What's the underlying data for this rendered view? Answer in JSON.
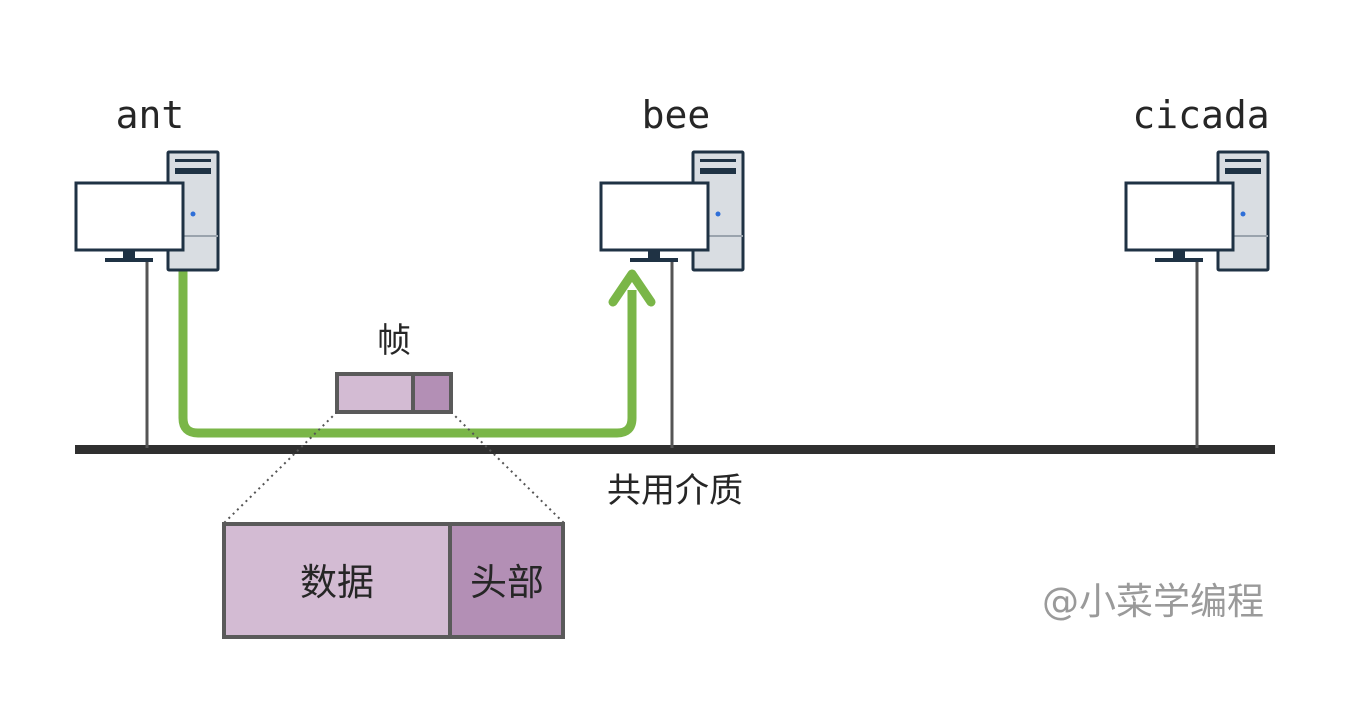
{
  "hosts": [
    {
      "name": "ant"
    },
    {
      "name": "bee"
    },
    {
      "name": "cicada"
    }
  ],
  "frame_label": "帧",
  "medium_label": "共用介质",
  "frame_parts": {
    "data_label": "数据",
    "header_label": "头部"
  },
  "watermark": "@小菜学编程",
  "colors": {
    "path": "#7ab648",
    "bus": "#2f2f2f",
    "data_fill": "#d3bbd3",
    "header_fill": "#b38fb5",
    "frame_border": "#5a5a5a",
    "computer_outline": "#1f3244",
    "tower_fill": "#d9dde2",
    "power_led": "#2f6fd8"
  }
}
